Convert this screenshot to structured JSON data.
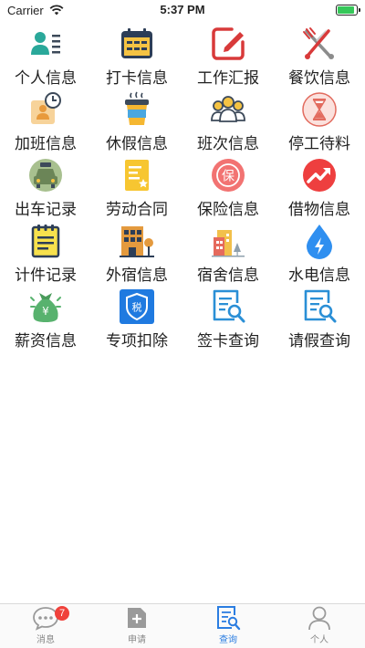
{
  "status_bar": {
    "carrier": "Carrier",
    "time": "5:37 PM",
    "battery_level": 0.9
  },
  "menu_items": [
    {
      "label": "个人信息",
      "icon": "person-id-icon"
    },
    {
      "label": "打卡信息",
      "icon": "calendar-icon"
    },
    {
      "label": "工作汇报",
      "icon": "edit-report-icon"
    },
    {
      "label": "餐饮信息",
      "icon": "fork-knife-icon"
    },
    {
      "label": "加班信息",
      "icon": "overtime-clock-icon"
    },
    {
      "label": "休假信息",
      "icon": "coffee-cup-icon"
    },
    {
      "label": "班次信息",
      "icon": "team-icon"
    },
    {
      "label": "停工待料",
      "icon": "hourglass-icon"
    },
    {
      "label": "出车记录",
      "icon": "taxi-icon"
    },
    {
      "label": "劳动合同",
      "icon": "contract-icon"
    },
    {
      "label": "保险信息",
      "icon": "insurance-icon"
    },
    {
      "label": "借物信息",
      "icon": "trend-up-icon"
    },
    {
      "label": "计件记录",
      "icon": "notepad-icon"
    },
    {
      "label": "外宿信息",
      "icon": "building-icon"
    },
    {
      "label": "宿舍信息",
      "icon": "dormitory-icon"
    },
    {
      "label": "水电信息",
      "icon": "water-electric-icon"
    },
    {
      "label": "薪资信息",
      "icon": "money-bag-icon"
    },
    {
      "label": "专项扣除",
      "icon": "tax-shield-icon"
    },
    {
      "label": "签卡查询",
      "icon": "doc-search-icon"
    },
    {
      "label": "请假查询",
      "icon": "doc-search-icon"
    }
  ],
  "tabs": [
    {
      "label": "消息",
      "icon": "chat-bubble-icon",
      "badge": "7"
    },
    {
      "label": "申请",
      "icon": "add-document-icon",
      "badge": ""
    },
    {
      "label": "查询",
      "icon": "query-document-icon",
      "badge": ""
    },
    {
      "label": "个人",
      "icon": "person-icon",
      "badge": ""
    }
  ],
  "active_tab": 2,
  "colors": {
    "accent": "#2b7de1",
    "badge": "#f0413b",
    "inactive": "#9a9a9a"
  }
}
